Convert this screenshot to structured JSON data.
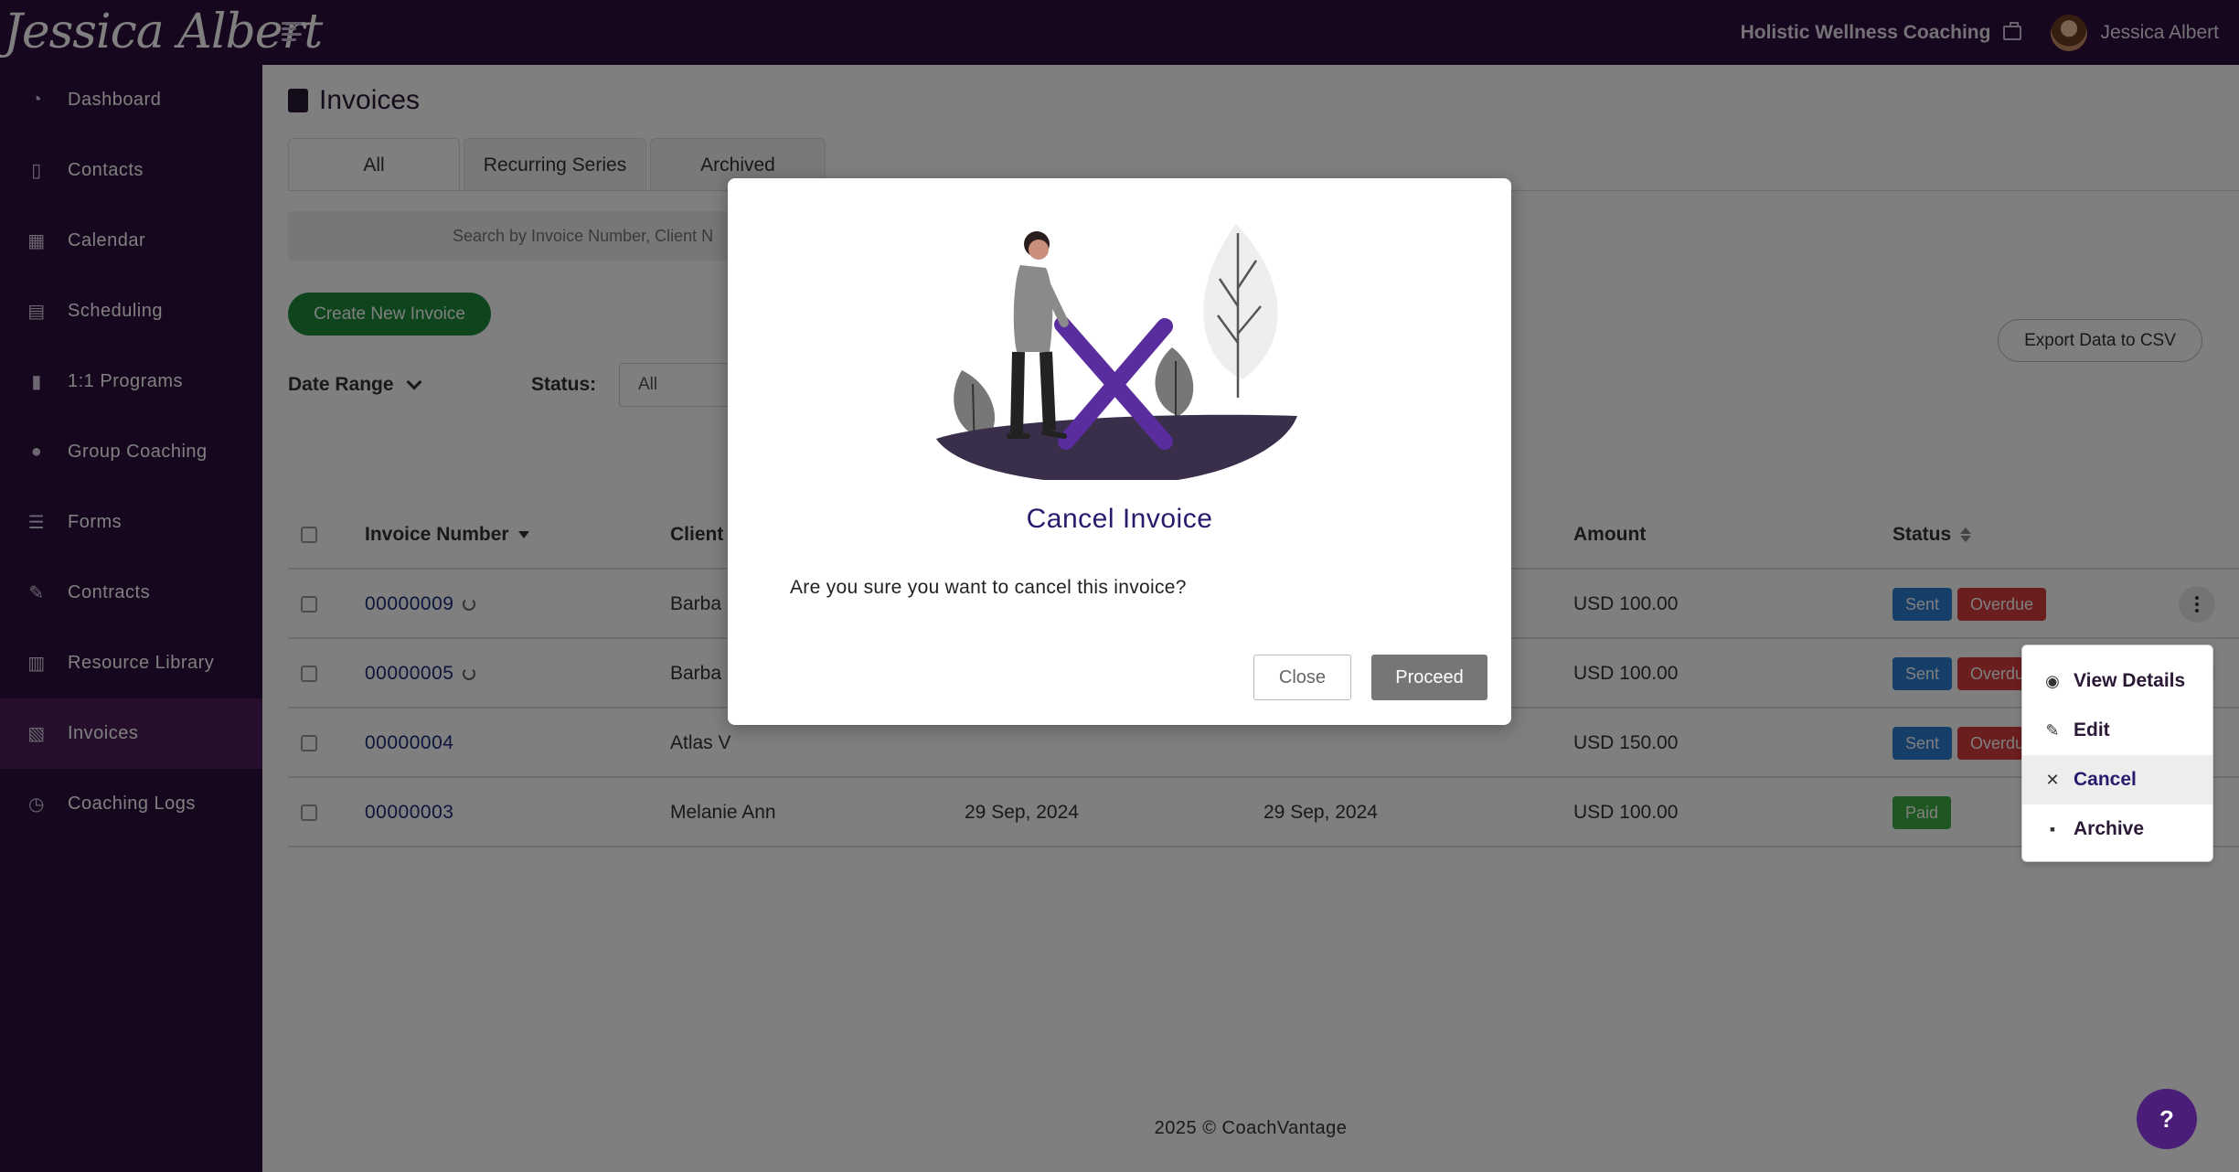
{
  "brand": {
    "logo_text": "Jessica Albert",
    "business_name": "Holistic Wellness Coaching",
    "user_name": "Jessica Albert"
  },
  "sidebar": {
    "items": [
      {
        "label": "Dashboard",
        "icon": "dashboard-icon"
      },
      {
        "label": "Contacts",
        "icon": "contacts-icon"
      },
      {
        "label": "Calendar",
        "icon": "calendar-icon"
      },
      {
        "label": "Scheduling",
        "icon": "scheduling-icon"
      },
      {
        "label": "1:1 Programs",
        "icon": "book-icon"
      },
      {
        "label": "Group Coaching",
        "icon": "group-icon"
      },
      {
        "label": "Forms",
        "icon": "forms-icon"
      },
      {
        "label": "Contracts",
        "icon": "contract-icon"
      },
      {
        "label": "Resource Library",
        "icon": "library-icon"
      },
      {
        "label": "Invoices",
        "icon": "invoice-icon"
      },
      {
        "label": "Coaching Logs",
        "icon": "clock-icon"
      }
    ],
    "active": "Invoices"
  },
  "page": {
    "title": "Invoices",
    "tabs": [
      "All",
      "Recurring Series",
      "Archived"
    ],
    "search_placeholder": "Search by Invoice Number, Client N",
    "create_label": "Create New Invoice",
    "export_label": "Export Data to CSV",
    "date_range_label": "Date Range",
    "status_label": "Status:",
    "status_value": "All"
  },
  "table": {
    "headers": {
      "invoice": "Invoice Number",
      "client": "Client",
      "amount": "Amount",
      "status": "Status"
    },
    "rows": [
      {
        "invoice": "00000009",
        "recurring": true,
        "client": "Barba",
        "issue": "",
        "due": "",
        "amount": "USD 100.00",
        "badges": [
          "Sent",
          "Overdue"
        ]
      },
      {
        "invoice": "00000005",
        "recurring": true,
        "client": "Barba",
        "issue": "",
        "due": "",
        "amount": "USD 100.00",
        "badges": [
          "Sent",
          "Overdue"
        ]
      },
      {
        "invoice": "00000004",
        "recurring": false,
        "client": "Atlas V",
        "issue": "",
        "due": "",
        "amount": "USD 150.00",
        "badges": [
          "Sent",
          "Overdue"
        ]
      },
      {
        "invoice": "00000003",
        "recurring": false,
        "client": "Melanie Ann",
        "issue": "29 Sep, 2024",
        "due": "29 Sep, 2024",
        "amount": "USD 100.00",
        "badges": [
          "Paid"
        ]
      }
    ]
  },
  "dropdown": {
    "items": [
      {
        "label": "View Details",
        "icon": "eye-icon"
      },
      {
        "label": "Edit",
        "icon": "pencil-icon"
      },
      {
        "label": "Cancel",
        "icon": "x-icon"
      },
      {
        "label": "Archive",
        "icon": "archive-icon"
      }
    ]
  },
  "modal": {
    "title": "Cancel Invoice",
    "message": "Are you sure you want to cancel this invoice?",
    "close_label": "Close",
    "proceed_label": "Proceed"
  },
  "footer": {
    "text": "2025 © CoachVantage"
  },
  "help": {
    "label": "?"
  },
  "colors": {
    "sidebar": "#2d0d3d",
    "active_nav": "#4a1e58",
    "create": "#1f8a3a",
    "sent": "#2a7fd1",
    "overdue": "#d63c3c",
    "paid": "#3fae44",
    "modal_title": "#2a1a6e",
    "x_mark": "#5a2d9e"
  }
}
